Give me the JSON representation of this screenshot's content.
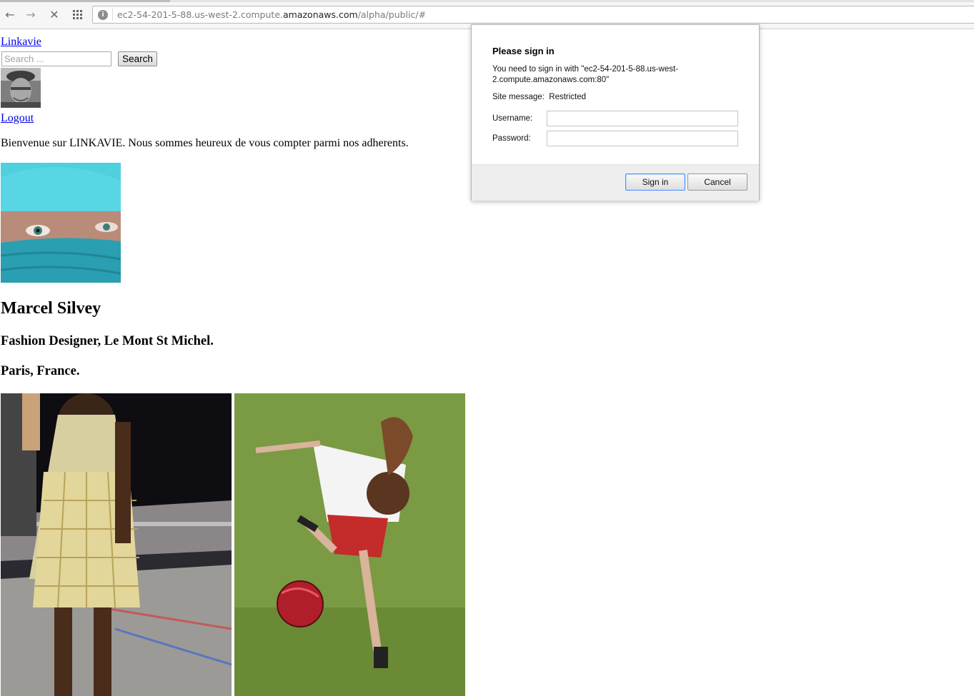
{
  "browser": {
    "url_prefix": "ec2-54-201-5-88.us-west-2.compute.",
    "url_domain": "amazonaws.com",
    "url_suffix": "/alpha/public/#",
    "back_icon": "arrow-left-icon",
    "forward_icon": "arrow-right-icon",
    "stop_icon": "close-icon",
    "apps_icon": "grid-icon",
    "site_info_icon": "info-icon"
  },
  "page": {
    "brand_link": "Linkavie",
    "search": {
      "placeholder": "Search ...",
      "value": "",
      "button_label": "Search"
    },
    "logout_link": "Logout",
    "welcome_text": "Bienvenue sur LINKAVIE. Nous sommes heureux de vous compter parmi nos adherents.",
    "profile": {
      "name": "Marcel Silvey",
      "title": "Fashion Designer, Le Mont St Michel.",
      "location": "Paris, France."
    }
  },
  "auth_dialog": {
    "title": "Please sign in",
    "message": "You need to sign in with \"ec2-54-201-5-88.us-west-2.compute.amazonaws.com:80\"",
    "site_message_label": "Site message:",
    "site_message_value": "Restricted",
    "username_label": "Username:",
    "username_value": "",
    "password_label": "Password:",
    "password_value": "",
    "signin_label": "Sign in",
    "cancel_label": "Cancel"
  },
  "colors": {
    "link": "#0000ee",
    "dialog_focus": "#4d90fe"
  }
}
